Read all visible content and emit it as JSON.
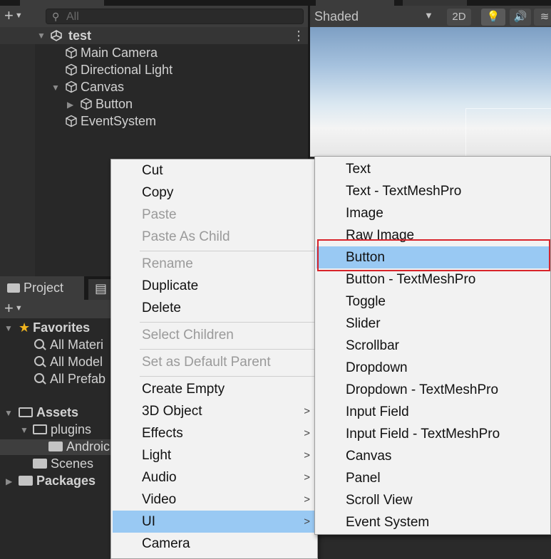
{
  "hierarchy": {
    "search_placeholder": "All",
    "scene_name": "test",
    "items": [
      {
        "label": "Main Camera"
      },
      {
        "label": "Directional Light"
      },
      {
        "label": "Canvas"
      },
      {
        "label": "Button"
      },
      {
        "label": "EventSystem"
      }
    ]
  },
  "scene_view": {
    "shading_mode": "Shaded",
    "toggle_2d": "2D"
  },
  "project": {
    "tab_label": "Project",
    "favorites": {
      "label": "Favorites",
      "items": [
        "All Materi",
        "All Model",
        "All Prefab"
      ]
    },
    "assets": {
      "label": "Assets",
      "plugins": "plugins",
      "android": "Androic",
      "scenes": "Scenes"
    },
    "packages": "Packages"
  },
  "context_menu": {
    "items": [
      {
        "label": "Cut",
        "enabled": true
      },
      {
        "label": "Copy",
        "enabled": true
      },
      {
        "label": "Paste",
        "enabled": false
      },
      {
        "label": "Paste As Child",
        "enabled": false
      },
      {
        "label": "Rename",
        "enabled": false
      },
      {
        "label": "Duplicate",
        "enabled": true
      },
      {
        "label": "Delete",
        "enabled": true
      },
      {
        "label": "Select Children",
        "enabled": false
      },
      {
        "label": "Set as Default Parent",
        "enabled": false
      },
      {
        "label": "Create Empty",
        "enabled": true
      },
      {
        "label": "3D Object",
        "enabled": true,
        "submenu": true
      },
      {
        "label": "Effects",
        "enabled": true,
        "submenu": true
      },
      {
        "label": "Light",
        "enabled": true,
        "submenu": true
      },
      {
        "label": "Audio",
        "enabled": true,
        "submenu": true
      },
      {
        "label": "Video",
        "enabled": true,
        "submenu": true
      },
      {
        "label": "UI",
        "enabled": true,
        "submenu": true,
        "highlighted": true
      },
      {
        "label": "Camera",
        "enabled": true
      }
    ]
  },
  "ui_submenu": {
    "items": [
      {
        "label": "Text"
      },
      {
        "label": "Text - TextMeshPro"
      },
      {
        "label": "Image"
      },
      {
        "label": "Raw Image"
      },
      {
        "label": "Button",
        "highlighted": true
      },
      {
        "label": "Button - TextMeshPro"
      },
      {
        "label": "Toggle"
      },
      {
        "label": "Slider"
      },
      {
        "label": "Scrollbar"
      },
      {
        "label": "Dropdown"
      },
      {
        "label": "Dropdown - TextMeshPro"
      },
      {
        "label": "Input Field"
      },
      {
        "label": "Input Field - TextMeshPro"
      },
      {
        "label": "Canvas"
      },
      {
        "label": "Panel"
      },
      {
        "label": "Scroll View"
      },
      {
        "label": "Event System"
      }
    ]
  },
  "colors": {
    "highlight": "#99c9f3",
    "annotation_box": "#d8232a",
    "favorite_star": "#f0b41e"
  }
}
